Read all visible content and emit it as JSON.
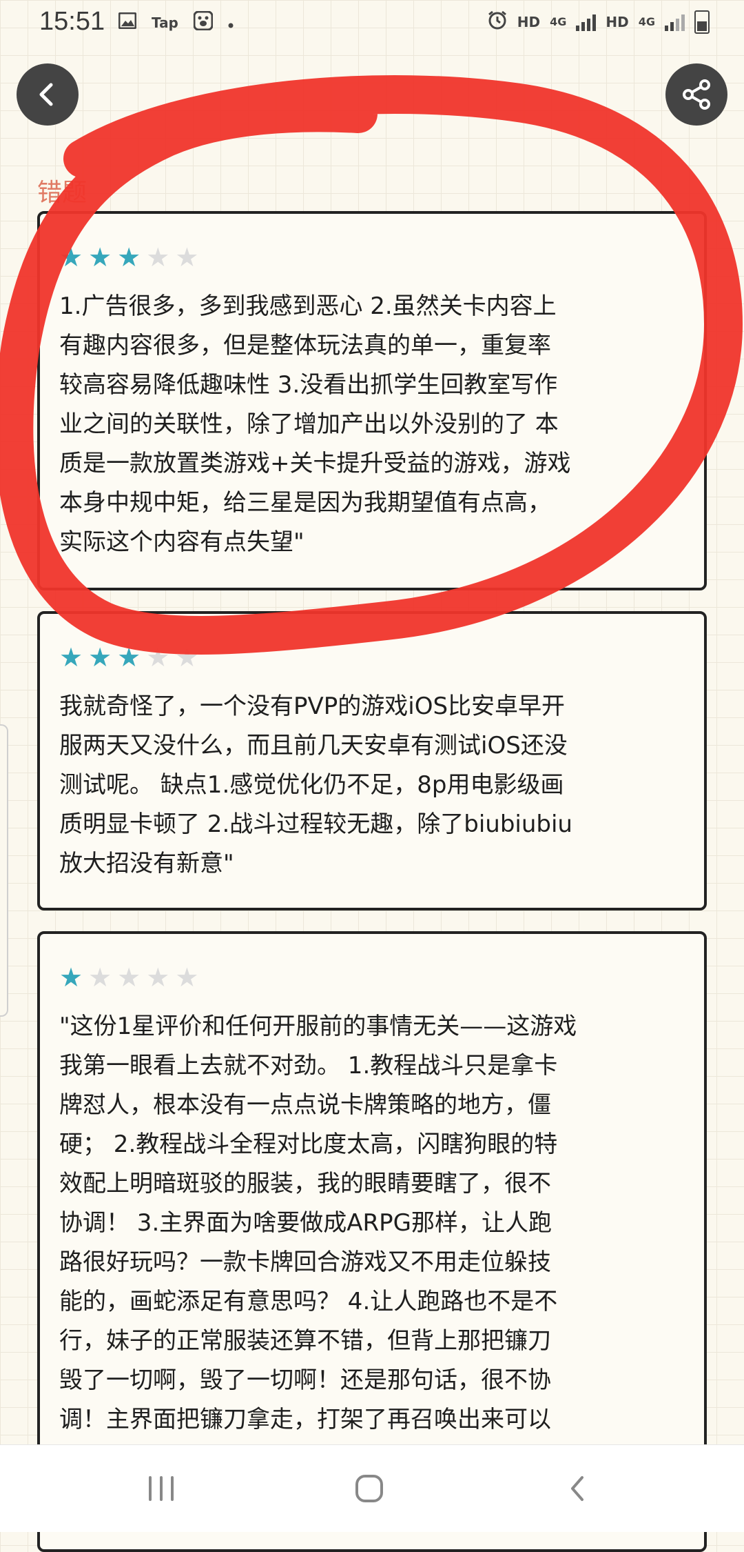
{
  "status_bar": {
    "time": "15:51",
    "left_icons": [
      "image-icon",
      "tap-app-icon",
      "baidu-paw-icon",
      "dot-icon"
    ],
    "tap_label": "Tap",
    "right_icons": [
      "alarm-icon",
      "signal-icon",
      "signal-icon",
      "battery-icon"
    ],
    "hd_label_1": "HD",
    "net_label_1": "4G",
    "hd_label_2": "HD",
    "net_label_2": "4G"
  },
  "header": {
    "back_icon": "chevron-left-icon",
    "share_icon": "share-icon"
  },
  "section": {
    "label": "错题"
  },
  "reviews": [
    {
      "rating": 3,
      "max_rating": 5,
      "text": "1.广告很多，多到我感到恶心 2.虽然关卡内容上\n有趣内容很多，但是整体玩法真的单一，重复率\n较高容易降低趣味性 3.没看出抓学生回教室写作\n业之间的关联性，除了增加产出以外没别的了 本\n质是一款放置类游戏+关卡提升受益的游戏，游戏\n本身中规中矩，给三星是因为我期望值有点高，\n实际这个内容有点失望\""
    },
    {
      "rating": 3,
      "max_rating": 5,
      "text": "我就奇怪了，一个没有PVP的游戏iOS比安卓早开\n服两天又没什么，而且前几天安卓有测试iOS还没\n测试呢。 缺点1.感觉优化仍不足，8p用电影级画\n质明显卡顿了 2.战斗过程较无趣，除了biubiubiu\n放大招没有新意\""
    },
    {
      "rating": 1,
      "max_rating": 5,
      "text": "\"这份1星评价和任何开服前的事情无关——这游戏\n我第一眼看上去就不对劲。 1.教程战斗只是拿卡\n牌怼人，根本没有一点点说卡牌策略的地方，僵\n硬； 2.教程战斗全程对比度太高，闪瞎狗眼的特\n效配上明暗斑驳的服装，我的眼睛要瞎了，很不\n协调！ 3.主界面为啥要做成ARPG那样，让人跑\n路很好玩吗？一款卡牌回合游戏又不用走位躲技\n能的，画蛇添足有意思吗？ 4.让人跑路也不是不\n行，妹子的正常服装还算不错，但背上那把镰刀\n毁了一切啊，毁了一切啊！还是那句话，很不协\n调！主界面把镰刀拿走，打架了再召唤出来可以"
    }
  ],
  "colors": {
    "star_on": "#36a7bb",
    "star_off": "#dcdcdc",
    "annotation": "#f0352b",
    "section_label": "#e07a64"
  },
  "nav_bar": {
    "icons": [
      "recent-apps-icon",
      "home-icon",
      "back-icon"
    ]
  }
}
